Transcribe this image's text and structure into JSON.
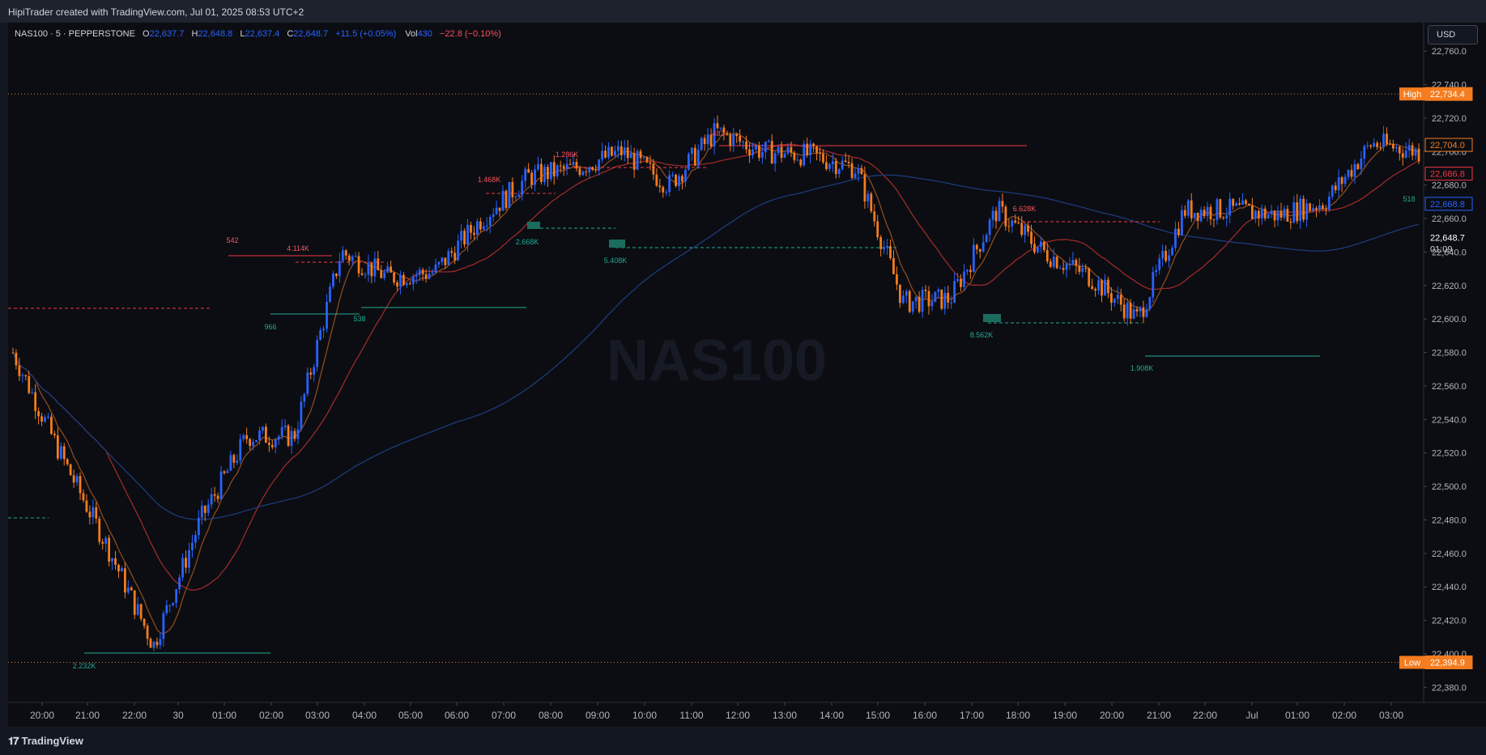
{
  "header": {
    "attribution": "HipiTrader created with TradingView.com, Jul 01, 2025 08:53 UTC+2"
  },
  "legend": {
    "symbol": "NAS100 · 5 · PEPPERSTONE",
    "open_label": "O",
    "open": "22,637.7",
    "high_label": "H",
    "high": "22,648.8",
    "low_label": "L",
    "low": "22,637.4",
    "close_label": "C",
    "close": "22,648.7",
    "change": "+11.5 (+0.05%)",
    "vol_label": "Vol",
    "vol": "430",
    "vol_change": "−22.8 (−0.10%)"
  },
  "currency_button": "USD",
  "watermark": "NAS100",
  "footer": {
    "brand": "TradingView",
    "logo_icon": "tradingview-logo-icon"
  },
  "colors": {
    "up": "#2962ff",
    "down": "#f57c1f",
    "background": "#0b0d12",
    "ma_fast": "#8b4a1e",
    "ma_mid": "#9c2a2a",
    "ma_slow": "#1e3a7a",
    "sell_line": "#f23645",
    "buy_line": "#22ab94"
  },
  "chart_data": {
    "type": "line",
    "title": "NAS100 · 5 · PEPPERSTONE",
    "x_ticks": [
      "20:00",
      "21:00",
      "22:00",
      "30",
      "01:00",
      "02:00",
      "03:00",
      "04:00",
      "05:00",
      "06:00",
      "07:00",
      "08:00",
      "09:00",
      "10:00",
      "11:00",
      "12:00",
      "13:00",
      "14:00",
      "15:00",
      "16:00",
      "17:00",
      "18:00",
      "19:00",
      "20:00",
      "21:00",
      "22:00",
      "Jul",
      "01:00",
      "02:00",
      "03:00"
    ],
    "y_ticks": [
      "22,760.0",
      "22,740.0",
      "22,720.0",
      "22,700.0",
      "22,680.0",
      "22,660.0",
      "22,640.0",
      "22,620.0",
      "22,600.0",
      "22,580.0",
      "22,560.0",
      "22,540.0",
      "22,520.0",
      "22,500.0",
      "22,480.0",
      "22,460.0",
      "22,440.0",
      "22,420.0",
      "22,400.0",
      "22,380.0"
    ],
    "ylim": [
      22371,
      22777
    ],
    "series": [
      {
        "name": "NAS100",
        "x": [
          0,
          1,
          2,
          3,
          4,
          5,
          6,
          7,
          8,
          9,
          10,
          11,
          12,
          13,
          14,
          15,
          16,
          17,
          18,
          19,
          20,
          21,
          22,
          23,
          24,
          25,
          26,
          27,
          28,
          29,
          30
        ],
        "values": [
          22580,
          22520,
          22465,
          22405,
          22480,
          22530,
          22530,
          22640,
          22625,
          22628,
          22660,
          22685,
          22690,
          22700,
          22680,
          22712,
          22700,
          22698,
          22690,
          22610,
          22612,
          22665,
          22640,
          22625,
          22600,
          22665,
          22665,
          22662,
          22670,
          22705,
          22700
        ]
      }
    ],
    "price_labels": [
      {
        "label": "High",
        "value": "22,734.4"
      },
      {
        "label": "",
        "value": "22,704.0"
      },
      {
        "label": "",
        "value": "22,686.8"
      },
      {
        "label": "",
        "value": "22,668.8"
      },
      {
        "label": "",
        "value": "22,648.7"
      },
      {
        "label": "",
        "value": "01:09"
      },
      {
        "label": "Low",
        "value": "22,394.9"
      }
    ],
    "volume_annotations": [
      {
        "text": "542",
        "side": "sell"
      },
      {
        "text": "4.114K",
        "side": "sell"
      },
      {
        "text": "1.468K",
        "side": "sell"
      },
      {
        "text": "1.286K",
        "side": "sell"
      },
      {
        "text": "482",
        "side": "sell"
      },
      {
        "text": "6.628K",
        "side": "sell"
      },
      {
        "text": "966",
        "side": "buy"
      },
      {
        "text": "538",
        "side": "buy"
      },
      {
        "text": "2.668K",
        "side": "buy"
      },
      {
        "text": "5.408K",
        "side": "buy"
      },
      {
        "text": "8.562K",
        "side": "buy"
      },
      {
        "text": "1.908K",
        "side": "buy"
      },
      {
        "text": "2.232K",
        "side": "buy"
      },
      {
        "text": "518",
        "side": "buy"
      }
    ]
  }
}
